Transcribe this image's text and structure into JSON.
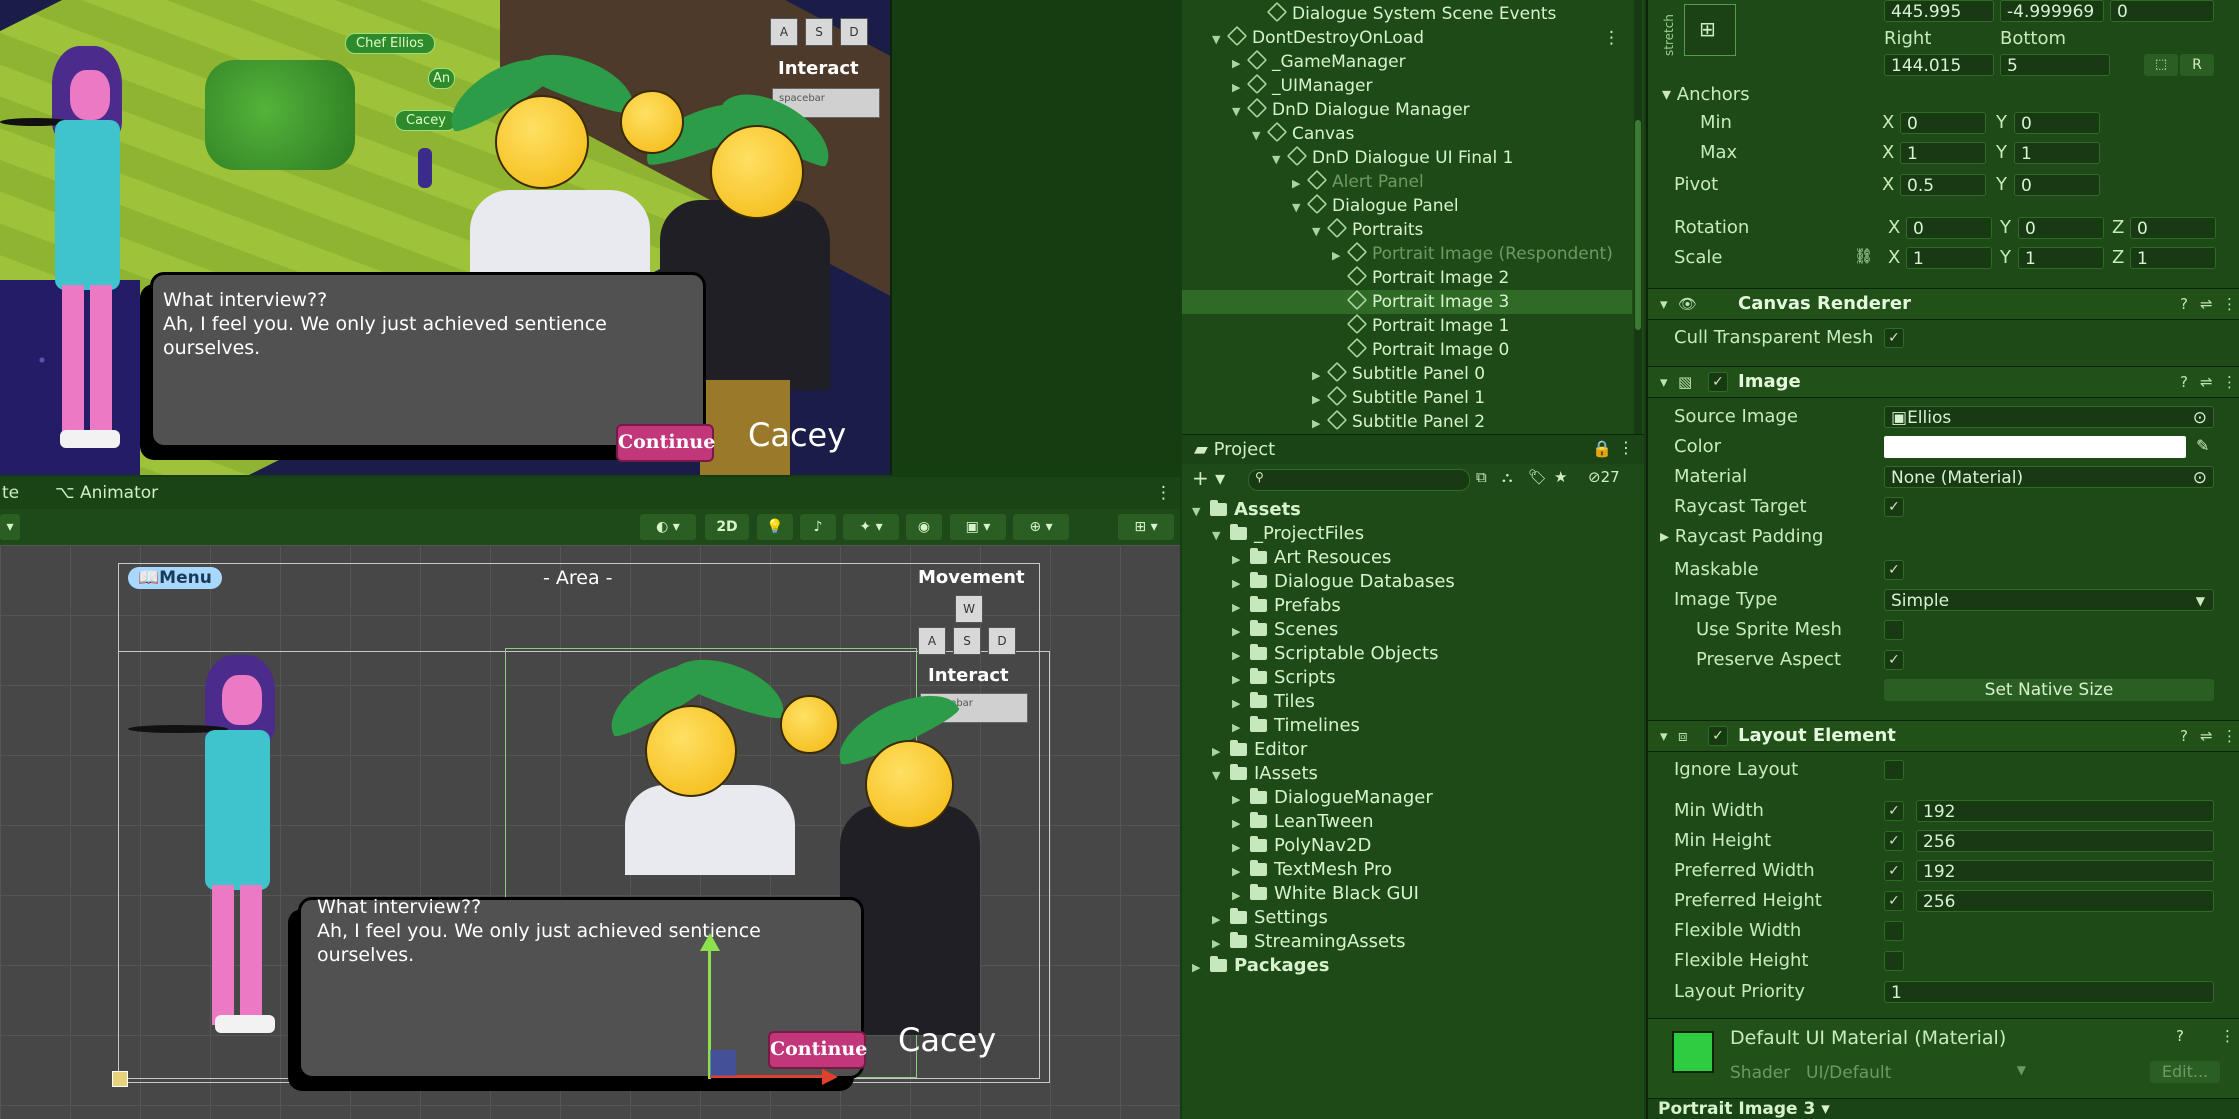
{
  "game": {
    "names": [
      "Chef Ellios",
      "Cacey",
      "An"
    ],
    "interact_label": "Interact",
    "spacebar": "spacebar",
    "keys": [
      "A",
      "S",
      "D"
    ],
    "dialogue_line1": "What interview??",
    "dialogue_line2": "Ah, I feel you. We only just achieved sentience",
    "dialogue_line3": "ourselves.",
    "continue": "Continue",
    "speaker": "Cacey"
  },
  "scene": {
    "tabs": [
      "te",
      "Animator"
    ],
    "toolbar_2d": "2D",
    "menu": "📖Menu",
    "area": "- Area -",
    "movement": "Movement",
    "keys_top": "W",
    "keys": [
      "A",
      "S",
      "D"
    ],
    "interact": "Interact",
    "spacebar": "spacebar",
    "dialogue_line1": "What interview??",
    "dialogue_line2": "Ah, I feel you. We only just achieved sentience",
    "dialogue_line3": "ourselves.",
    "continue": "Continue",
    "speaker": "Cacey"
  },
  "hierarchy": {
    "rows": [
      {
        "label": "Dialogue System Scene Events",
        "indent": 4,
        "dim": false
      },
      {
        "label": "DontDestroyOnLoad",
        "indent": 2,
        "dim": false
      },
      {
        "label": "_GameManager",
        "indent": 3,
        "dim": false
      },
      {
        "label": "_UIManager",
        "indent": 3,
        "dim": false
      },
      {
        "label": "DnD Dialogue Manager",
        "indent": 3,
        "dim": false
      },
      {
        "label": "Canvas",
        "indent": 4,
        "dim": false
      },
      {
        "label": "DnD Dialogue UI Final 1",
        "indent": 5,
        "dim": false
      },
      {
        "label": "Alert Panel",
        "indent": 6,
        "dim": true
      },
      {
        "label": "Dialogue Panel",
        "indent": 6,
        "dim": false
      },
      {
        "label": "Portraits",
        "indent": 7,
        "dim": false
      },
      {
        "label": "Portrait Image (Respondent)",
        "indent": 8,
        "dim": true
      },
      {
        "label": "Portrait Image 2",
        "indent": 8,
        "dim": false
      },
      {
        "label": "Portrait Image 3",
        "indent": 8,
        "dim": false
      },
      {
        "label": "Portrait Image 1",
        "indent": 8,
        "dim": false
      },
      {
        "label": "Portrait Image 0",
        "indent": 8,
        "dim": false
      },
      {
        "label": "Subtitle Panel 0",
        "indent": 7,
        "dim": false
      },
      {
        "label": "Subtitle Panel 1",
        "indent": 7,
        "dim": false
      },
      {
        "label": "Subtitle Panel 2",
        "indent": 7,
        "dim": false
      }
    ]
  },
  "project": {
    "tab": "Project",
    "count": "27",
    "rows": [
      {
        "label": "Assets",
        "indent": 0,
        "bold": true
      },
      {
        "label": "_ProjectFiles",
        "indent": 1,
        "bold": false
      },
      {
        "label": "Art Resouces",
        "indent": 2,
        "bold": false
      },
      {
        "label": "Dialogue Databases",
        "indent": 2,
        "bold": false
      },
      {
        "label": "Prefabs",
        "indent": 2,
        "bold": false
      },
      {
        "label": "Scenes",
        "indent": 2,
        "bold": false
      },
      {
        "label": "Scriptable Objects",
        "indent": 2,
        "bold": false
      },
      {
        "label": "Scripts",
        "indent": 2,
        "bold": false
      },
      {
        "label": "Tiles",
        "indent": 2,
        "bold": false
      },
      {
        "label": "Timelines",
        "indent": 2,
        "bold": false
      },
      {
        "label": "Editor",
        "indent": 1,
        "bold": false
      },
      {
        "label": "IAssets",
        "indent": 1,
        "bold": false
      },
      {
        "label": "DialogueManager",
        "indent": 2,
        "bold": false
      },
      {
        "label": "LeanTween",
        "indent": 2,
        "bold": false
      },
      {
        "label": "PolyNav2D",
        "indent": 2,
        "bold": false
      },
      {
        "label": "TextMesh Pro",
        "indent": 2,
        "bold": false
      },
      {
        "label": "White Black GUI",
        "indent": 2,
        "bold": false
      },
      {
        "label": "Settings",
        "indent": 1,
        "bold": false
      },
      {
        "label": "StreamingAssets",
        "indent": 1,
        "bold": false
      },
      {
        "label": "Packages",
        "indent": 0,
        "bold": true
      }
    ]
  },
  "inspector": {
    "stretch": "stretch",
    "pos_top": [
      "445.995",
      "-4.999969",
      "0"
    ],
    "right_label": "Right",
    "bottom_label": "Bottom",
    "right_value": "144.015",
    "bottom_value": "5",
    "r_button": "R",
    "anchors": "Anchors",
    "min": "Min",
    "max": "Max",
    "pivot": "Pivot",
    "rotation": "Rotation",
    "scale": "Scale",
    "x": "X",
    "y": "Y",
    "z": "Z",
    "anchor_min": [
      "0",
      "0"
    ],
    "anchor_max": [
      "1",
      "1"
    ],
    "pivot_vals": [
      "0.5",
      "0"
    ],
    "rotation_vals": [
      "0",
      "0",
      "0"
    ],
    "scale_vals": [
      "1",
      "1",
      "1"
    ],
    "canvas_renderer": "Canvas Renderer",
    "cull_transparent_mesh": "Cull Transparent Mesh",
    "image": "Image",
    "source_image": "Source Image",
    "source_image_value": "Ellios",
    "color": "Color",
    "material": "Material",
    "material_value": "None (Material)",
    "raycast_target": "Raycast Target",
    "raycast_padding": "Raycast Padding",
    "maskable": "Maskable",
    "image_type": "Image Type",
    "image_type_value": "Simple",
    "use_sprite_mesh": "Use Sprite Mesh",
    "preserve_aspect": "Preserve Aspect",
    "set_native_size": "Set Native Size",
    "layout_element": "Layout Element",
    "ignore_layout": "Ignore Layout",
    "min_width": "Min Width",
    "min_width_value": "192",
    "min_height": "Min Height",
    "min_height_value": "256",
    "preferred_width": "Preferred Width",
    "preferred_width_value": "192",
    "preferred_height": "Preferred Height",
    "preferred_height_value": "256",
    "flexible_width": "Flexible Width",
    "flexible_height": "Flexible Height",
    "layout_priority": "Layout Priority",
    "layout_priority_value": "1",
    "default_material": "Default UI Material (Material)",
    "shader": "Shader",
    "shader_value": "UI/Default",
    "edit": "Edit...",
    "footer": "Portrait Image 3 ▾",
    "check": "✓",
    "material_color": "#2ecc40",
    "color_value": "#ffffff"
  }
}
